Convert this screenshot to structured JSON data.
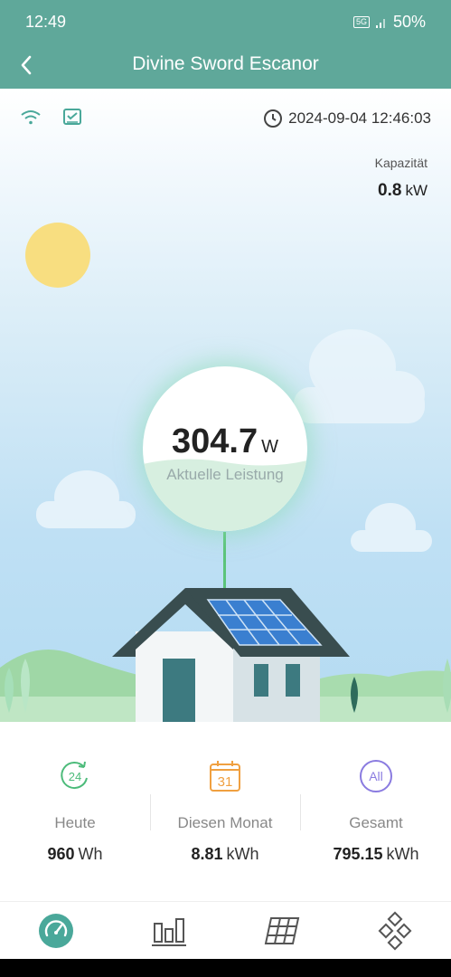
{
  "status_bar": {
    "time": "12:49",
    "network": "5G",
    "battery": "50%"
  },
  "app_bar": {
    "title": "Divine Sword Escanor",
    "back_icon": "back-arrow-icon"
  },
  "device": {
    "datetime": "2024-09-04 12:46:03",
    "capacity_label": "Kapazität",
    "capacity_value": "0.8",
    "capacity_unit": "kW"
  },
  "power": {
    "value": "304.7",
    "unit": "W",
    "label": "Aktuelle Leistung"
  },
  "stats": [
    {
      "icon_text": "24",
      "icon": "24h-icon",
      "label": "Heute",
      "value": "960",
      "unit": "Wh",
      "color": "#4cbb7a"
    },
    {
      "icon_text": "31",
      "icon": "calendar-icon",
      "label": "Diesen Monat",
      "value": "8.81",
      "unit": "kWh",
      "color": "#f0a040"
    },
    {
      "icon_text": "All",
      "icon": "all-icon",
      "label": "Gesamt",
      "value": "795.15",
      "unit": "kWh",
      "color": "#8a7be0"
    }
  ],
  "tabs": [
    {
      "icon": "dashboard-icon",
      "active": true
    },
    {
      "icon": "bar-chart-icon",
      "active": false
    },
    {
      "icon": "solar-panel-icon",
      "active": false
    },
    {
      "icon": "more-icon",
      "active": false
    }
  ],
  "colors": {
    "header": "#5fa89a",
    "accent": "#4aa89a"
  }
}
